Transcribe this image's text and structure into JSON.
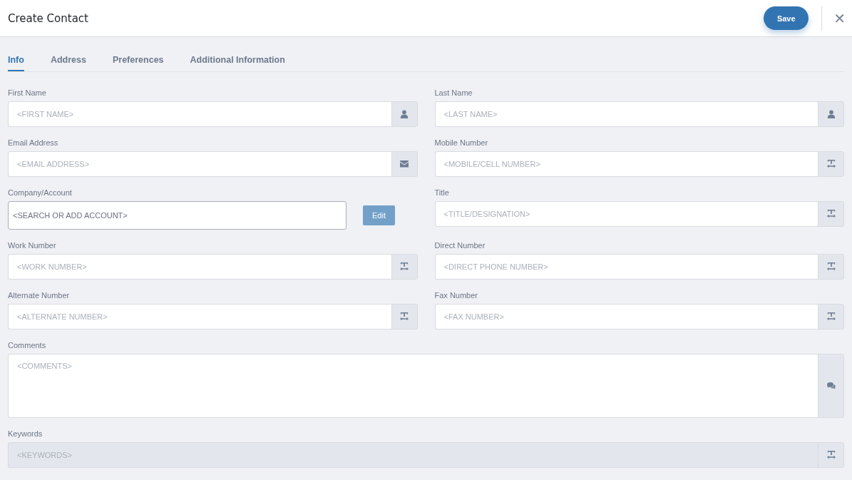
{
  "header": {
    "title": "Create Contact",
    "save_button": "Save",
    "close_button": "✕"
  },
  "tabs": [
    {
      "label": "Info",
      "selected": true
    },
    {
      "label": "Address",
      "selected": false
    },
    {
      "label": "Preferences",
      "selected": false
    },
    {
      "label": "Additional Information",
      "selected": false
    }
  ],
  "rows": [
    {
      "fields": [
        {
          "kind": "name",
          "label": "First Name",
          "placeholder": "<FIRST NAME>",
          "disabled": false
        },
        {
          "kind": "name",
          "label": "Last Name",
          "placeholder": "<LAST NAME>",
          "disabled": false
        }
      ]
    },
    {
      "fields": [
        {
          "kind": "email",
          "label": "Email Address",
          "placeholder": "<EMAIL ADDRESS>",
          "disabled": false
        },
        {
          "kind": "text",
          "label": "Mobile Number",
          "placeholder": "<MOBILE/CELL NUMBER>",
          "disabled": false
        }
      ]
    },
    {
      "fields": [
        {
          "kind": "account",
          "label": "Company/Account",
          "placeholder": "<SEARCH OR ADD ACCOUNT>",
          "button": "Edit"
        },
        {
          "kind": "text",
          "label": "Title",
          "placeholder": "<TITLE/DESIGNATION>",
          "disabled": false
        }
      ]
    },
    {
      "fields": [
        {
          "kind": "text",
          "label": "Work Number",
          "placeholder": "<WORK NUMBER>",
          "disabled": false
        },
        {
          "kind": "text",
          "label": "Direct Number",
          "placeholder": "<DIRECT PHONE NUMBER>",
          "disabled": false
        }
      ]
    },
    {
      "fields": [
        {
          "kind": "text",
          "label": "Alternate Number",
          "placeholder": "<ALTERNATE NUMBER>",
          "disabled": false
        },
        {
          "kind": "text",
          "label": "Fax Number",
          "placeholder": "<FAX NUMBER>",
          "disabled": false
        }
      ]
    },
    {
      "fields": [
        {
          "kind": "comments",
          "label": "Comments",
          "placeholder": "<COMMENTS>",
          "disabled": false
        }
      ]
    },
    {
      "fields": [
        {
          "kind": "text",
          "label": "Keywords",
          "placeholder": "<KEYWORDS>",
          "disabled": true
        }
      ]
    }
  ]
}
